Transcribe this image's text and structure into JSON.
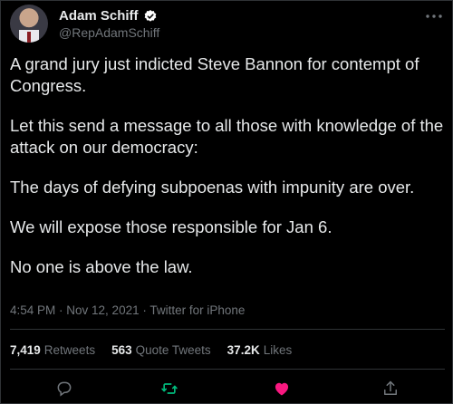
{
  "author": {
    "name": "Adam Schiff",
    "handle": "@RepAdamSchiff",
    "verified_icon": "verified-badge-icon"
  },
  "tweet": {
    "paragraphs": [
      "A grand jury just indicted Steve Bannon for contempt of Congress.",
      "Let this send a message to all those with knowledge of the attack on our democracy:",
      "The days of defying subpoenas with impunity are over.",
      "We will expose those responsible for Jan 6.",
      "No one is above the law."
    ],
    "time": "4:54 PM",
    "date": "Nov 12, 2021",
    "source": "Twitter for iPhone",
    "separator": " · "
  },
  "stats": {
    "retweets_count": "7,419",
    "retweets_label": "Retweets",
    "quotes_count": "563",
    "quotes_label": "Quote Tweets",
    "likes_count": "37.2K",
    "likes_label": "Likes"
  },
  "colors": {
    "background": "#000000",
    "text": "#e7e9ea",
    "muted": "#71767b",
    "retweet_active": "#00ba7c",
    "like_active": "#f91880",
    "verified": "#ffffff"
  }
}
